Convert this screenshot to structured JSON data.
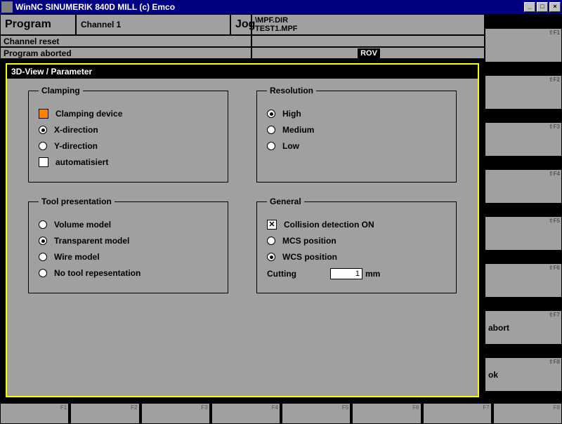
{
  "window": {
    "title": "WinNC SINUMERIK 840D MILL (c) Emco"
  },
  "header": {
    "mode_left": "Program",
    "channel": "Channel 1",
    "mode_right": "Jog",
    "path_dir": "\\MPF.DIR",
    "path_file": "TEST1.MPF",
    "status1": "Channel reset",
    "status2": "Program aborted",
    "badge": "ROV"
  },
  "panel": {
    "title": "3D-View / Parameter",
    "clamping": {
      "legend": "Clamping",
      "device": "Clamping device",
      "xdir": "X-direction",
      "ydir": "Y-direction",
      "auto": "automatisiert",
      "selected": "xdir"
    },
    "resolution": {
      "legend": "Resolution",
      "high": "High",
      "medium": "Medium",
      "low": "Low",
      "selected": "high"
    },
    "tool": {
      "legend": "Tool presentation",
      "volume": "Volume model",
      "transparent": "Transparent model",
      "wire": "Wire model",
      "none": "No tool repesentation",
      "selected": "transparent"
    },
    "general": {
      "legend": "General",
      "collision": "Collision detection ON",
      "collision_checked": true,
      "mcs": "MCS position",
      "wcs": "WCS position",
      "pos_selected": "wcs",
      "cutting_label": "Cutting",
      "cutting_value": "1",
      "cutting_unit": "mm"
    }
  },
  "softkeys_right": {
    "f1": "",
    "f2": "",
    "f3": "",
    "f4": "",
    "f5": "",
    "f6": "",
    "f7": "abort",
    "f8": "ok",
    "lbl_f1": "⇧F1",
    "lbl_f2": "⇧F2",
    "lbl_f3": "⇧F3",
    "lbl_f4": "⇧F4",
    "lbl_f5": "⇧F5",
    "lbl_f6": "⇧F6",
    "lbl_f7": "⇧F7",
    "lbl_f8": "⇧F8"
  },
  "softkeys_bottom": {
    "lbl_f1": "F1",
    "lbl_f2": "F2",
    "lbl_f3": "F3",
    "lbl_f4": "F4",
    "lbl_f5": "F5",
    "lbl_f6": "F6",
    "lbl_f7": "F7",
    "lbl_f8": "F8"
  }
}
